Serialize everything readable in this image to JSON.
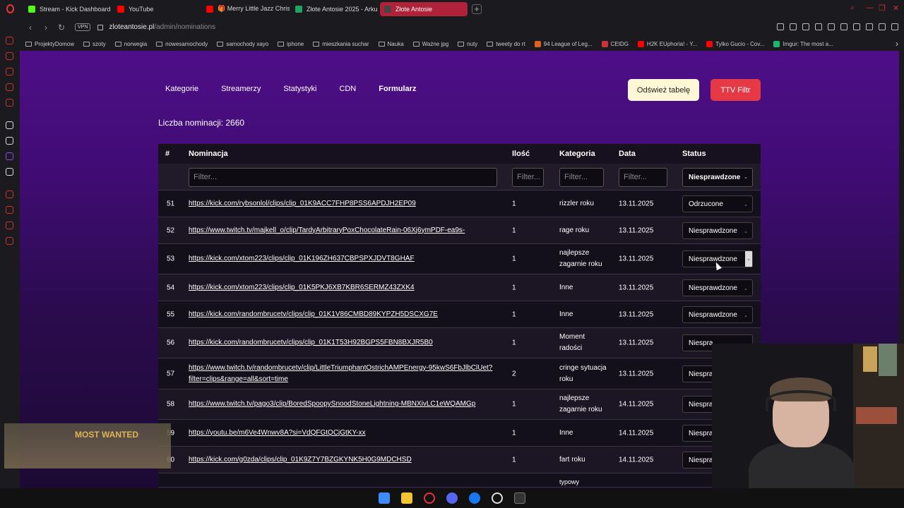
{
  "browser": {
    "tabs": [
      {
        "title": "Stream - Kick Dashboard",
        "icon": "kick-icon",
        "color": "#53fc18",
        "active": false
      },
      {
        "title": "YouTube",
        "icon": "youtube-icon",
        "color": "#ff0000",
        "active": false
      },
      {
        "title": "🎁 Merry Little Jazz Chris",
        "icon": "youtube-icon",
        "color": "#ff0000",
        "active": false
      },
      {
        "title": "Złote Antosie 2025 - Arku",
        "icon": "sheets-icon",
        "color": "#1fa463",
        "active": false
      },
      {
        "title": "Złote Antosie",
        "icon": "site-icon",
        "color": "#444444",
        "active": true
      }
    ],
    "new_tab": "+",
    "vpn": "VPN",
    "url_host": "zloteantosie.pl",
    "url_path": "/admin/nominations",
    "bookmarks": [
      {
        "label": "ProjektyDomow",
        "icon": "folder-icon"
      },
      {
        "label": "szoty",
        "icon": "folder-icon"
      },
      {
        "label": "norwegia",
        "icon": "folder-icon"
      },
      {
        "label": "nowesamochody",
        "icon": "folder-icon"
      },
      {
        "label": "samochody xayo",
        "icon": "folder-icon"
      },
      {
        "label": "iphone",
        "icon": "folder-icon"
      },
      {
        "label": "mieszkania suchar",
        "icon": "folder-icon"
      },
      {
        "label": "Nauka",
        "icon": "folder-icon"
      },
      {
        "label": "Ważne jpg",
        "icon": "folder-icon"
      },
      {
        "label": "nuty",
        "icon": "folder-icon"
      },
      {
        "label": "tweety do rt",
        "icon": "folder-icon"
      },
      {
        "label": "94 League of Leg...",
        "icon": "lol-icon",
        "color": "#e06020"
      },
      {
        "label": "CEIDG",
        "icon": "ceidg-icon",
        "color": "#cc3333"
      },
      {
        "label": "H2K EUphoria! - Y...",
        "icon": "youtube-icon",
        "color": "#ff0000"
      },
      {
        "label": "Tylko Gucio - Cov...",
        "icon": "youtube-icon",
        "color": "#ff0000"
      },
      {
        "label": "Imgur: The most a...",
        "icon": "imgur-icon",
        "color": "#1bb76e"
      }
    ]
  },
  "nav": {
    "items": [
      "Kategorie",
      "Streamerzy",
      "Statystyki",
      "CDN",
      "Formularz"
    ],
    "refresh_button": "Odśwież tabelę",
    "ttv_button": "TTV Filtr"
  },
  "count_label": "Liczba nominacji: 2660",
  "table": {
    "headers": [
      "#",
      "Nominacja",
      "Ilość",
      "Kategoria",
      "Data",
      "Status"
    ],
    "filter_placeholder": "Filter...",
    "status_filter": "Niesprawdzone",
    "rows": [
      {
        "n": "51",
        "link": "https://kick.com/rybsonlol/clips/clip_01K9ACC7FHP8PSS6APDJH2EP09",
        "qty": "1",
        "cat": "rizzler roku",
        "date": "13.11.2025",
        "status": "Odrzucone"
      },
      {
        "n": "52",
        "link": "https://www.twitch.tv/majkell_o/clip/TardyArbitraryPoxChocolateRain-06Xj6ymPDF-ea9s-",
        "qty": "1",
        "cat": "rage roku",
        "date": "13.11.2025",
        "status": "Niesprawdzone"
      },
      {
        "n": "53",
        "link": "https://kick.com/xtom223/clips/clip_01K196ZH637CBPSPXJDVT8GHAF",
        "qty": "1",
        "cat": "najlepsze zagarnie roku",
        "date": "13.11.2025",
        "status": "Niesprawdzone"
      },
      {
        "n": "54",
        "link": "https://kick.com/xtom223/clips/clip_01K5PKJ6XB7KBR6SERMZ43ZXK4",
        "qty": "1",
        "cat": "Inne",
        "date": "13.11.2025",
        "status": "Niesprawdzone"
      },
      {
        "n": "55",
        "link": "https://kick.com/randombrucetv/clips/clip_01K1V86CMBD89KYPZH5DSCXG7E",
        "qty": "1",
        "cat": "Inne",
        "date": "13.11.2025",
        "status": "Niesprawdzone"
      },
      {
        "n": "56",
        "link": "https://kick.com/randombrucetv/clips/clip_01K1T53H92BGPS5FBN8BXJR5B0",
        "qty": "1",
        "cat": "Moment radości",
        "date": "13.11.2025",
        "status": "Niespra"
      },
      {
        "n": "57",
        "link": "https://www.twitch.tv/randombrucetv/clip/LittleTriumphantOstrichAMPEnergy-95kwS6FbJlbClUet?filter=clips&range=all&sort=time",
        "qty": "2",
        "cat": "cringe sytuacja roku",
        "date": "13.11.2025",
        "status": "Niespra"
      },
      {
        "n": "58",
        "link": "https://www.twitch.tv/pago3/clip/BoredSpoopySnoodStoneLightning-MBNXivLC1eWQAMGp",
        "qty": "1",
        "cat": "najlepsze zagarnie roku",
        "date": "14.11.2025",
        "status": "Niespra"
      },
      {
        "n": "59",
        "link": "https://youtu.be/m6Ve4Wnwv8A?si=VdQFGtQCjGtKY-xx",
        "qty": "1",
        "cat": "Inne",
        "date": "14.11.2025",
        "status": "Niespra"
      },
      {
        "n": "60",
        "link": "https://kick.com/g0zda/clips/clip_01K9Z7Y7BZGKYNK5H0G9MDCHSD",
        "qty": "1",
        "cat": "fart roku",
        "date": "14.11.2025",
        "status": "Niespra"
      }
    ],
    "partial_next_cat": "typowy"
  },
  "overlay": {
    "game_text": "MOST WANTED"
  }
}
